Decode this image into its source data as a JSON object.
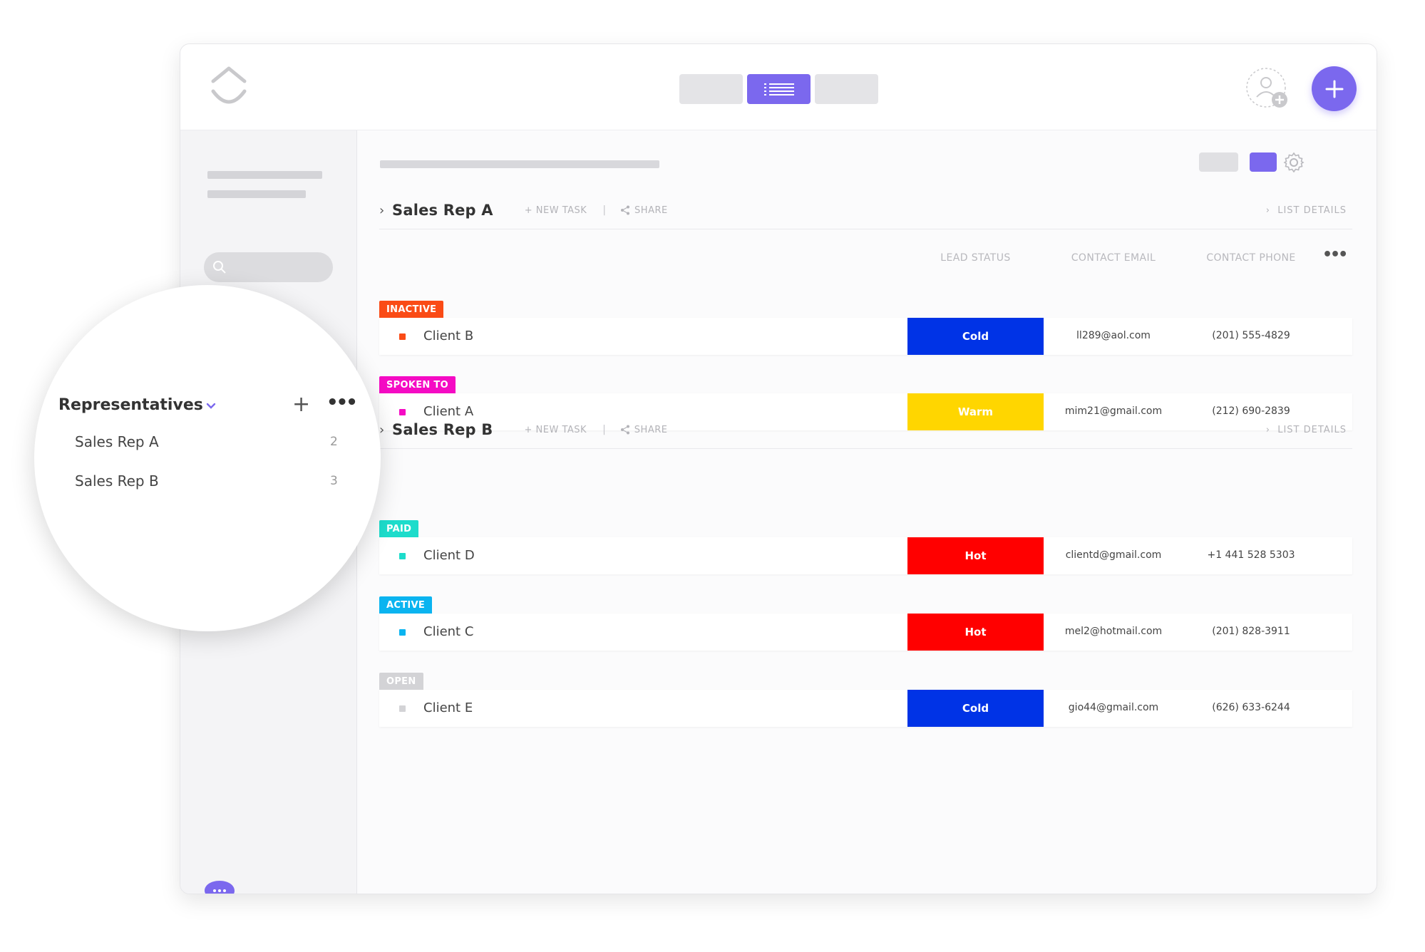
{
  "colors": {
    "accent": "#7b68ee",
    "inactive": "#fa4b16",
    "spoken_to": "#f50bc4",
    "paid": "#1ddccb",
    "active": "#0ab4f0",
    "open": "#d3d3d6",
    "cold": "#0033e6",
    "warm": "#ffd600",
    "hot": "#ff0000"
  },
  "toolbar": {
    "view_icon": "list-view-icon",
    "invite_icon": "add-user-icon",
    "add_icon": "plus-icon"
  },
  "sidebar": {
    "panel_title": "Representatives",
    "items": [
      {
        "label": "Sales Rep A",
        "count": "2"
      },
      {
        "label": "Sales Rep B",
        "count": "3"
      }
    ]
  },
  "columns": {
    "lead_status": "LEAD STATUS",
    "contact_email": "CONTACT EMAIL",
    "contact_phone": "CONTACT PHONE"
  },
  "lists": [
    {
      "title": "Sales Rep A",
      "new_task": "+ NEW TASK",
      "separator": "|",
      "share": "SHARE",
      "details": "LIST DETAILS",
      "groups": [
        {
          "status": "INACTIVE",
          "color": "#fa4b16",
          "task": "Client B",
          "lead": "Cold",
          "lead_color": "#0033e6",
          "email": "ll289@aol.com",
          "phone": "(201) 555-4829"
        },
        {
          "status": "SPOKEN TO",
          "color": "#f50bc4",
          "task": "Client A",
          "lead": "Warm",
          "lead_color": "#ffd600",
          "email": "mim21@gmail.com",
          "phone": "(212) 690-2839"
        }
      ]
    },
    {
      "title": "Sales Rep B",
      "new_task": "+ NEW TASK",
      "separator": "|",
      "share": "SHARE",
      "details": "LIST DETAILS",
      "groups": [
        {
          "status": "PAID",
          "color": "#1ddccb",
          "task": "Client D",
          "lead": "Hot",
          "lead_color": "#ff0000",
          "email": "clientd@gmail.com",
          "phone": "+1 441 528 5303"
        },
        {
          "status": "ACTIVE",
          "color": "#0ab4f0",
          "task": "Client C",
          "lead": "Hot",
          "lead_color": "#ff0000",
          "email": "mel2@hotmail.com",
          "phone": "(201) 828-3911"
        },
        {
          "status": "OPEN",
          "color": "#d3d3d6",
          "task": "Client E",
          "lead": "Cold",
          "lead_color": "#0033e6",
          "email": "gio44@gmail.com",
          "phone": "(626) 633-6244"
        }
      ]
    }
  ]
}
